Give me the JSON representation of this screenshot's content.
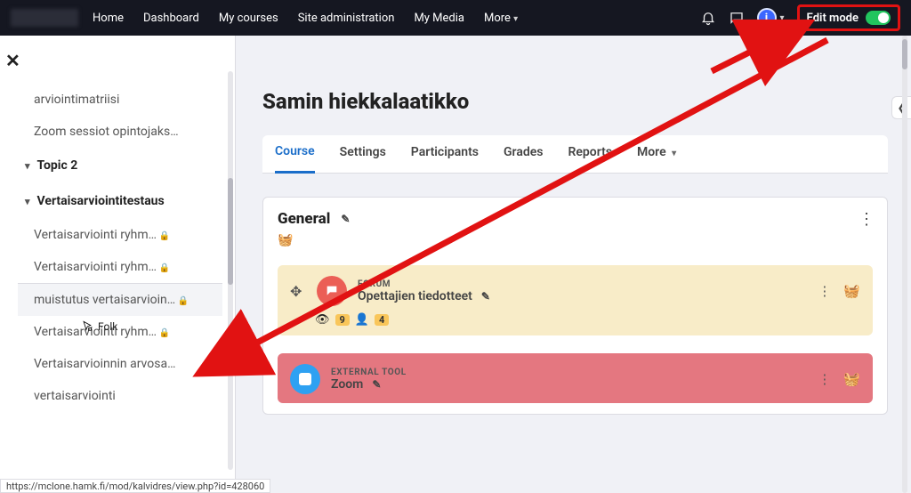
{
  "nav": {
    "links": [
      "Home",
      "Dashboard",
      "My courses",
      "Site administration",
      "My Media",
      "More"
    ],
    "editmode_label": "Edit mode",
    "avatar_letter": "i"
  },
  "sidebar": {
    "items_top": [
      {
        "label": "arviointimatriisi",
        "locked": false
      },
      {
        "label": "Zoom sessiot opintojaks…",
        "locked": false
      }
    ],
    "section_topic2": "Topic 2",
    "section_vertais": "Vertaisarviointitestaus",
    "items_vertais": [
      {
        "label": "Vertaisarviointi ryhm…",
        "locked": true,
        "hover": false
      },
      {
        "label": "Vertaisarviointi ryhm…",
        "locked": true,
        "hover": false
      },
      {
        "label": "muistutus vertaisarvioin…",
        "locked": true,
        "hover": true
      },
      {
        "label": "Vertaisarviointi ryhm…",
        "locked": true,
        "hover": false
      },
      {
        "label": "Vertaisarvioinnin arvosa…",
        "locked": false,
        "hover": false
      },
      {
        "label": "vertaisarviointi",
        "locked": false,
        "hover": false
      }
    ],
    "cursor_label": "Folk"
  },
  "page": {
    "title": "Samin hiekkalaatikko",
    "tabs": [
      "Course",
      "Settings",
      "Participants",
      "Grades",
      "Reports",
      "More"
    ]
  },
  "section": {
    "title": "General",
    "activities": [
      {
        "kind": "forum",
        "type_label": "FORUM",
        "title": "Opettajien tiedotteet",
        "badges": {
          "views": "9",
          "members": "4"
        }
      },
      {
        "kind": "ext",
        "type_label": "EXTERNAL TOOL",
        "title": "Zoom"
      }
    ]
  },
  "statusbar": "https://mclone.hamk.fi/mod/kalvidres/view.php?id=428060"
}
